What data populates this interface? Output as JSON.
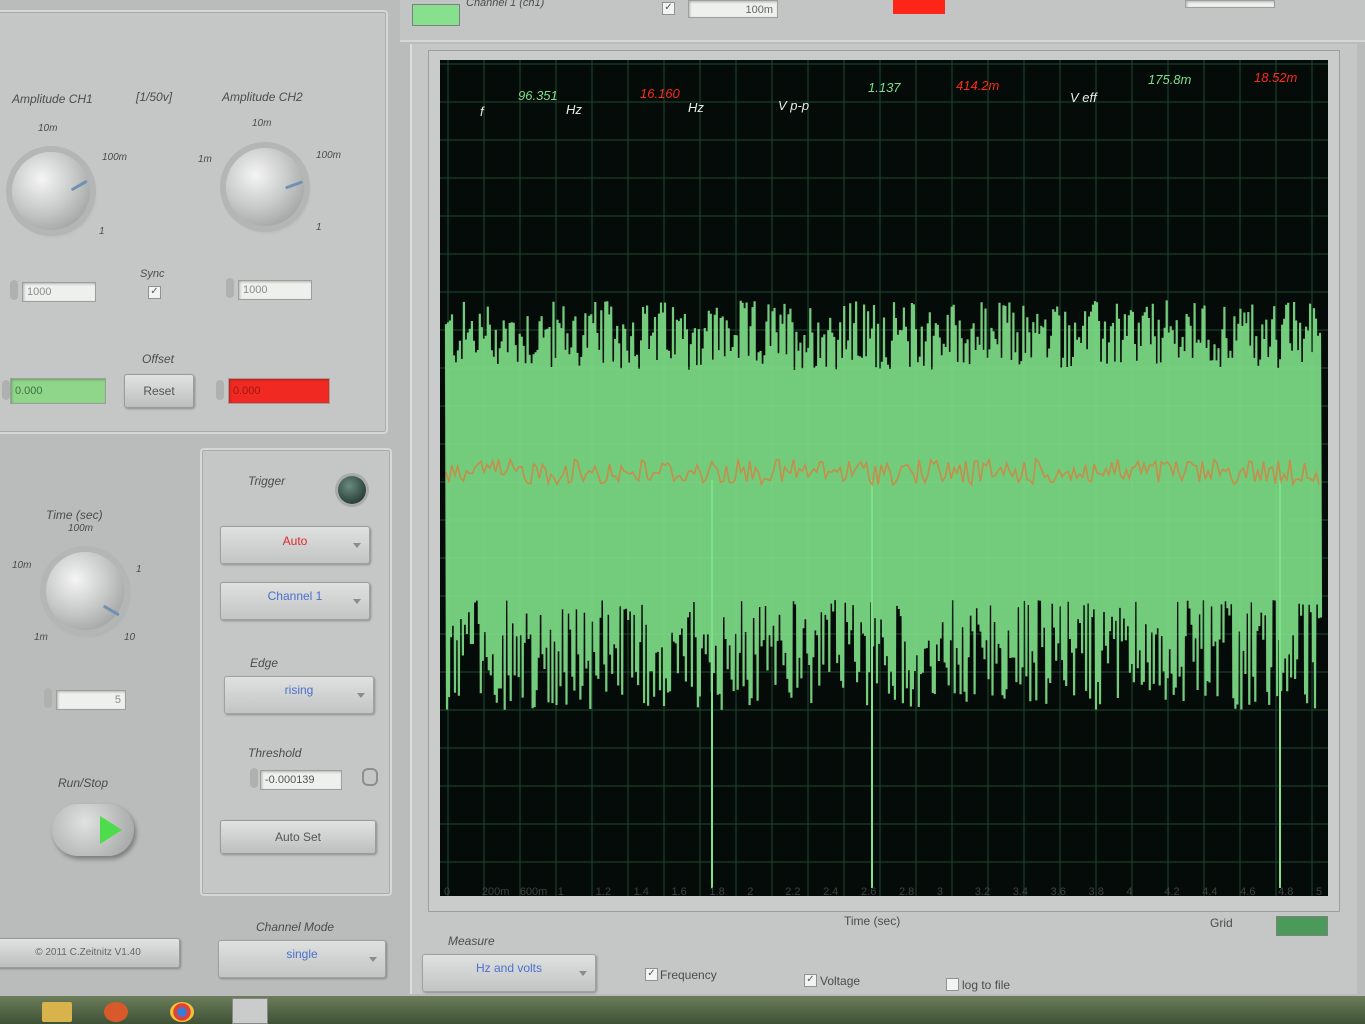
{
  "top": {
    "channel_label": "Channel 1 (ch1)",
    "value_field": "100m"
  },
  "amplitude_ch1": {
    "label": "Amplitude CH1",
    "unit": "[1/50v]",
    "ticks": [
      "10m",
      "100m",
      "1"
    ],
    "field": "1000",
    "offset_field": "0.000"
  },
  "amplitude_ch2": {
    "label": "Amplitude CH2",
    "ticks": [
      "1m",
      "10m",
      "100m",
      "1"
    ],
    "field": "1000",
    "offset_field": "0.000"
  },
  "sync": {
    "label": "Sync"
  },
  "offset": {
    "label": "Offset",
    "reset_label": "Reset"
  },
  "time": {
    "label": "Time (sec)",
    "ticks": [
      "10m",
      "100m",
      "1",
      "1m",
      "10"
    ],
    "field": "5"
  },
  "run_stop": {
    "label": "Run/Stop"
  },
  "trigger": {
    "label": "Trigger",
    "mode": "Auto",
    "channel": "Channel 1",
    "edge_label": "Edge",
    "edge": "rising",
    "threshold_label": "Threshold",
    "threshold": "-0.000139",
    "autoset_label": "Auto Set"
  },
  "channel_mode": {
    "label": "Channel Mode",
    "value": "single"
  },
  "copyright": "© 2011 C.Zeitnitz V1.40",
  "measure": {
    "label": "Measure",
    "value": "Hz and volts",
    "frequency_label": "Frequency",
    "voltage_label": "Voltage",
    "log_label": "log to file"
  },
  "grid_label": "Grid",
  "scope": {
    "f_label": "f",
    "f_ch1": "96.351",
    "f_ch2": "16.160",
    "hz": "Hz",
    "vpp_label": "V p-p",
    "vpp_ch1": "1.137",
    "vpp_ch2": "414.2m",
    "veff_label": "V eff",
    "veff_ch1": "175.8m",
    "veff_ch2": "18.52m",
    "x_axis_label": "Time (sec)",
    "x_ticks": [
      "0",
      "200m",
      "600m",
      "1",
      "1.2",
      "1.4",
      "1.6",
      "1.8",
      "2",
      "2.2",
      "2.4",
      "2.6",
      "2.8",
      "3",
      "3.2",
      "3.4",
      "3.6",
      "3.8",
      "4",
      "4.2",
      "4.4",
      "4.6",
      "4.8",
      "5"
    ]
  },
  "colors": {
    "ch1": "#7fe08a",
    "ch2": "#ff2a1a",
    "screen": "#050b08",
    "grid": "#1f4a2e"
  }
}
